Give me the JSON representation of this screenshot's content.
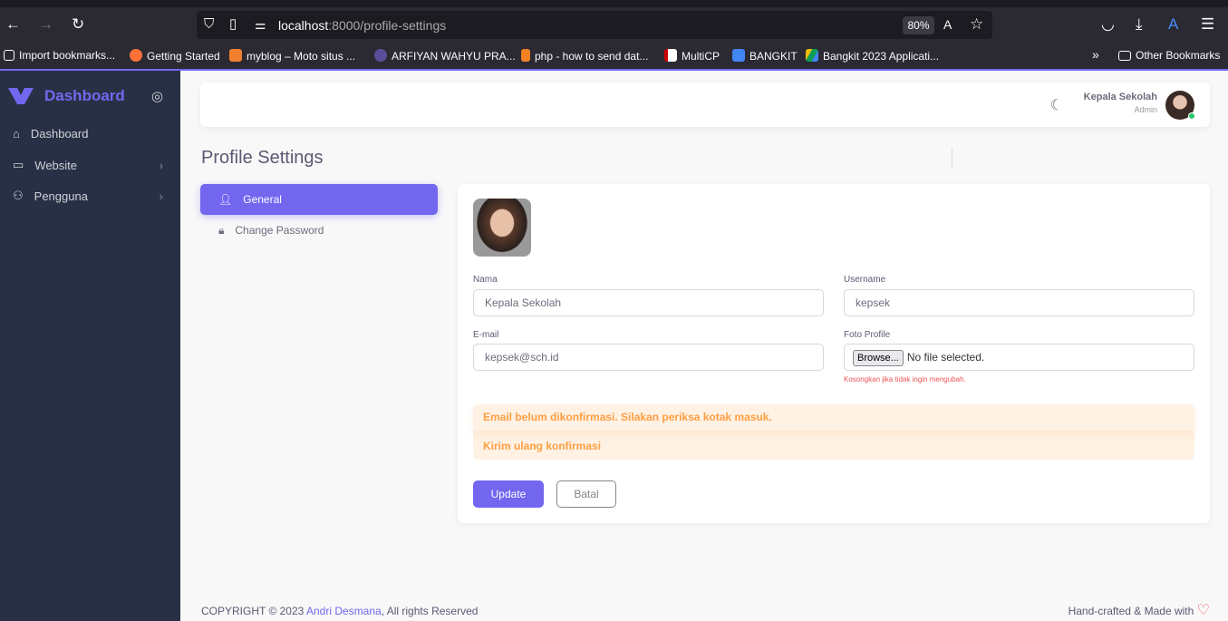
{
  "browser": {
    "url_host": "localhost",
    "url_path": ":8000/profile-settings",
    "zoom": "80%",
    "bookmarks": [
      {
        "label": "Import bookmarks...",
        "color": "transparent"
      },
      {
        "label": "Getting Started",
        "color": "#ff7139"
      },
      {
        "label": "myblog – Moto situs ...",
        "color": "#f08030"
      },
      {
        "label": "ARFIYAN WAHYU PRA...",
        "color": "#5a4e9a"
      },
      {
        "label": "php - how to send dat...",
        "color": "#f48024"
      },
      {
        "label": "MultiCP",
        "color": "#ffffff"
      },
      {
        "label": "BANGKIT",
        "color": "#4285f4"
      },
      {
        "label": "Bangkit 2023 Applicati...",
        "color": "#0f9d58"
      }
    ],
    "other_bookmarks": "Other Bookmarks"
  },
  "sidebar": {
    "brand": "Dashboard",
    "items": [
      {
        "label": "Dashboard"
      },
      {
        "label": "Website"
      },
      {
        "label": "Pengguna"
      }
    ]
  },
  "header": {
    "user_name": "Kepala Sekolah",
    "user_role": "Admin"
  },
  "page": {
    "title": "Profile Settings",
    "tabs": [
      {
        "label": "General"
      },
      {
        "label": "Change Password"
      }
    ]
  },
  "form": {
    "nama_label": "Nama",
    "nama_value": "Kepala Sekolah",
    "username_label": "Username",
    "username_value": "kepsek",
    "email_label": "E-mail",
    "email_value": "kepsek@sch.id",
    "foto_label": "Foto Profile",
    "browse_label": "Browse...",
    "no_file": "No file selected.",
    "foto_hint": "Kosongkan jika tidak ingin mengubah.",
    "alert_heading": "Email belum dikonfirmasi. Silakan periksa kotak masuk.",
    "alert_link": "Kirim ulang konfirmasi",
    "update_label": "Update",
    "cancel_label": "Batal"
  },
  "footer": {
    "copyright": "COPYRIGHT © 2023 ",
    "author": "Andri Desmana",
    "rights": ", All rights Reserved",
    "made": "Hand-crafted & Made with"
  }
}
